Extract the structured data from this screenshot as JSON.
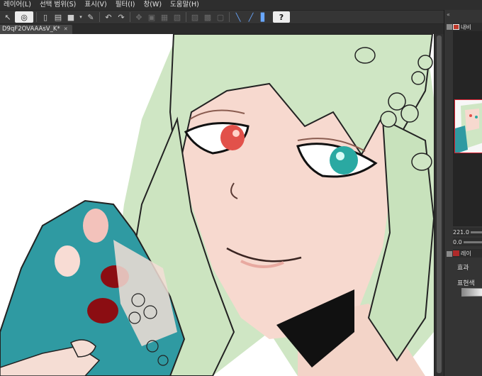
{
  "menu": {
    "items": [
      {
        "id": "layer",
        "label": "레이어(L)"
      },
      {
        "id": "select",
        "label": "선택 범위(S)"
      },
      {
        "id": "view",
        "label": "표시(V)"
      },
      {
        "id": "filter",
        "label": "필터(I)"
      },
      {
        "id": "window",
        "label": "창(W)"
      },
      {
        "id": "help",
        "label": "도움말(H)"
      }
    ]
  },
  "toolbar": {
    "help_label": "?"
  },
  "document_tab": {
    "title": "D9qF2OVAAAsV_K*",
    "close": "✕"
  },
  "right_panel": {
    "navigator_label": "내비",
    "rotation_value": "221.0",
    "angle_value": "0.0",
    "layer_label": "레이",
    "effect_label": "효과",
    "expression_color_label": "표현색"
  },
  "colors": {
    "hair": "#cfe6c4",
    "skin": "#f7d6cc",
    "left_eye": "#e2514a",
    "right_eye": "#2aa9a2",
    "glove": "#2f9aa2",
    "glove_spot_dark": "#8b0d12",
    "glove_spot_light": "#f3c2bb"
  }
}
